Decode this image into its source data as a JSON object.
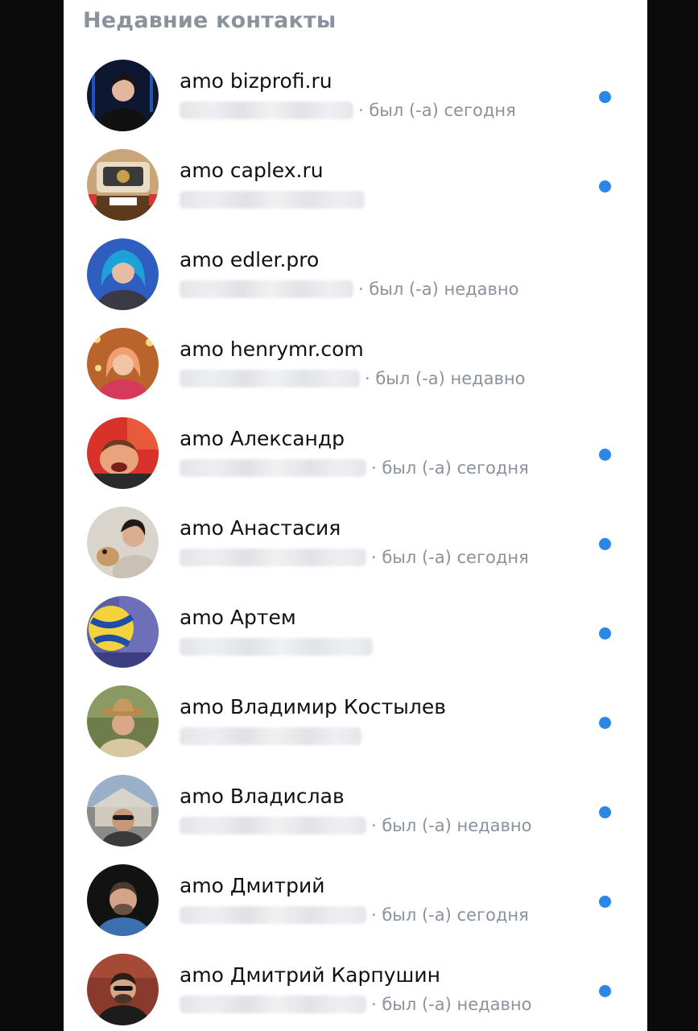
{
  "section": {
    "title": "Недавние контакты"
  },
  "contacts": [
    {
      "name": "amo bizprofi.ru",
      "status": "· был (-а) сегодня",
      "online": true
    },
    {
      "name": "amo caplex.ru",
      "status": "",
      "online": true
    },
    {
      "name": "amo edler.pro",
      "status": "· был (-а) недавно",
      "online": false
    },
    {
      "name": "amo henrymr.com",
      "status": "· был (-а) недавно",
      "online": false
    },
    {
      "name": "amo Александр",
      "status": "· был (-а) сегодня",
      "online": true
    },
    {
      "name": "amo Анастасия",
      "status": "· был (-а) сегодня",
      "online": true
    },
    {
      "name": "amo Артем",
      "status": "",
      "online": true
    },
    {
      "name": "amo Владимир Костылев",
      "status": "",
      "online": true
    },
    {
      "name": "amo Владислав",
      "status": "· был (-а) недавно",
      "online": true
    },
    {
      "name": "amo Дмитрий",
      "status": "· был (-а) сегодня",
      "online": true
    },
    {
      "name": "amo Дмитрий Карпушин",
      "status": "· был (-а) недавно",
      "online": true
    }
  ],
  "colors": {
    "accent": "#2a87e6",
    "secondary_text": "#8a929e",
    "primary_text": "#111111"
  }
}
